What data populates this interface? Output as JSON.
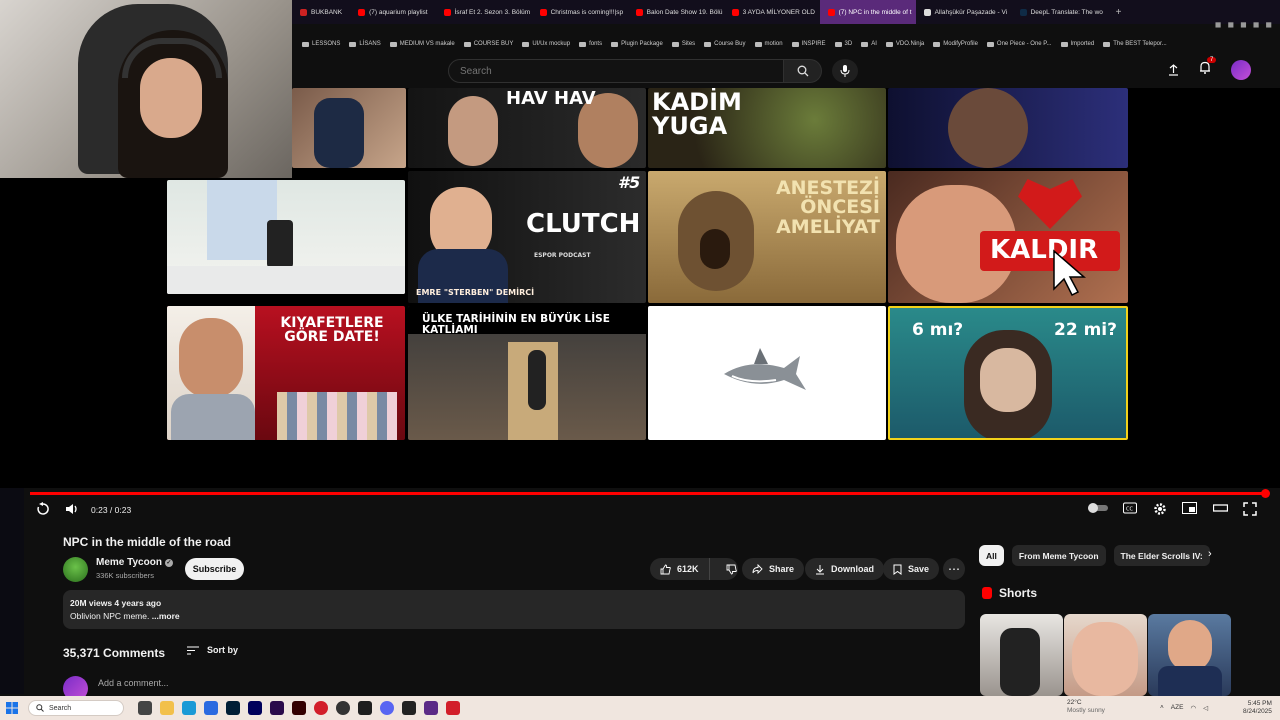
{
  "browser": {
    "tabs": [
      {
        "label": "BUKBANK",
        "color": "#cc2222",
        "active": false
      },
      {
        "label": "(7) aquarium playlist",
        "color": "#ff0000",
        "active": false
      },
      {
        "label": "İsraf Et 2. Sezon 3. Bölüm",
        "color": "#ff0000",
        "active": false
      },
      {
        "label": "Christmas is coming!!!|sp",
        "color": "#ff0000",
        "active": false
      },
      {
        "label": "Balon Date Show 19. Bölü",
        "color": "#ff0000",
        "active": false
      },
      {
        "label": "3 AYDA MİLYONER OLD",
        "color": "#ff0000",
        "active": false
      },
      {
        "label": "(7) NPC in the middle of t",
        "color": "#ff0000",
        "active": true
      },
      {
        "label": "Allahşükür Paşazade - Vi",
        "color": "#dddddd",
        "active": false
      },
      {
        "label": "DeepL Translate: The wo",
        "color": "#0f2b46",
        "active": false
      }
    ],
    "new_tab_label": "+",
    "bookmarks": [
      "LESSONS",
      "LİSANS",
      "MEDIUM VS makale",
      "COURSE BUY",
      "UI/Ux mockup",
      "fonts",
      "Plugin Package",
      "Sites",
      "Course Buy",
      "motion",
      "INSPIRE",
      "3D",
      "AI",
      "VDO.Ninja",
      "ModifyProfile",
      "One Piece - One P...",
      "Imported",
      "The BEST Telepor..."
    ]
  },
  "header": {
    "search_placeholder": "Search",
    "notification_count": "7"
  },
  "thumbnails": {
    "t1": "HAV HAV",
    "t2": "KADİM YUGA",
    "t3_num": "#5",
    "t3_title": "CLUTCH",
    "t3_sub": "ESPOR PODCAST",
    "t3_name": "EMRE \"STERBEN\" DEMİRCİ",
    "t4": "ANESTEZİ ÖNCESİ AMELİYAT",
    "t5": "KALDIR",
    "t6": "KIYAFETLERE GÖRE DATE!",
    "t7": "ÜLKE TARİHİNİN EN BÜYÜK LİSE KATLİAMI",
    "t8_left": "6 mı?",
    "t8_right": "22 mi?"
  },
  "player": {
    "time": "0:23 / 0:23",
    "progress": 1.0
  },
  "video": {
    "title": "NPC in the middle of the road",
    "channel": "Meme Tycoon",
    "subscribers": "336K subscribers",
    "subscribe_label": "Subscribe",
    "likes": "612K",
    "share_label": "Share",
    "download_label": "Download",
    "save_label": "Save",
    "more_label": "⋯",
    "stats": "20M views  4 years ago",
    "description": "Oblivion NPC meme.",
    "more_link": "...more"
  },
  "comments": {
    "count": "35,371 Comments",
    "sort_label": "Sort by",
    "add_placeholder": "Add a comment..."
  },
  "sidebar_right": {
    "chips": [
      "All",
      "From Meme Tycoon",
      "The Elder Scrolls IV:"
    ],
    "shorts_title": "Shorts"
  },
  "taskbar": {
    "search_placeholder": "Search",
    "weather_temp": "22°C",
    "weather_desc": "Mostly sunny",
    "lang": "AZE",
    "time": "5:45 PM",
    "date": "8/24/2025"
  },
  "colors": {
    "accent": "#ff0000",
    "active_tab": "#5a2a7a",
    "background": "#0f0f0f"
  }
}
